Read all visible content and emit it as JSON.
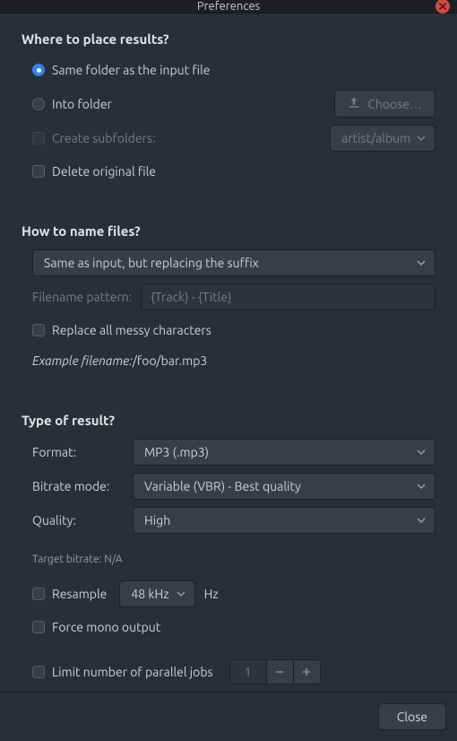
{
  "window": {
    "title": "Preferences"
  },
  "sections": {
    "place": {
      "heading": "Where to place results?",
      "same_folder": "Same folder as the input file",
      "into_folder": "Into folder",
      "choose": "Choose…",
      "create_subfolders": "Create subfolders:",
      "subfolder_pattern": "artist/album",
      "delete_original": "Delete original file"
    },
    "name": {
      "heading": "How to name files?",
      "mode_selected": "Same as input, but replacing the suffix",
      "pattern_label": "Filename pattern:",
      "pattern_value": "{Track} - {Title}",
      "replace_messy": "Replace all messy characters",
      "example_label": "Example filename:",
      "example_value": " /foo/bar.mp3"
    },
    "type": {
      "heading": "Type of result?",
      "format_label": "Format:",
      "format_value": "MP3 (.mp3)",
      "bitrate_mode_label": "Bitrate mode:",
      "bitrate_mode_value": "Variable (VBR) - Best quality",
      "quality_label": "Quality:",
      "quality_value": "High",
      "target_bitrate": "Target bitrate: N/A",
      "resample": "Resample",
      "resample_value": "48 kHz",
      "resample_unit": "Hz",
      "force_mono": "Force mono output",
      "limit_jobs": "Limit number of parallel jobs",
      "limit_jobs_value": "1"
    }
  },
  "footer": {
    "close": "Close"
  }
}
